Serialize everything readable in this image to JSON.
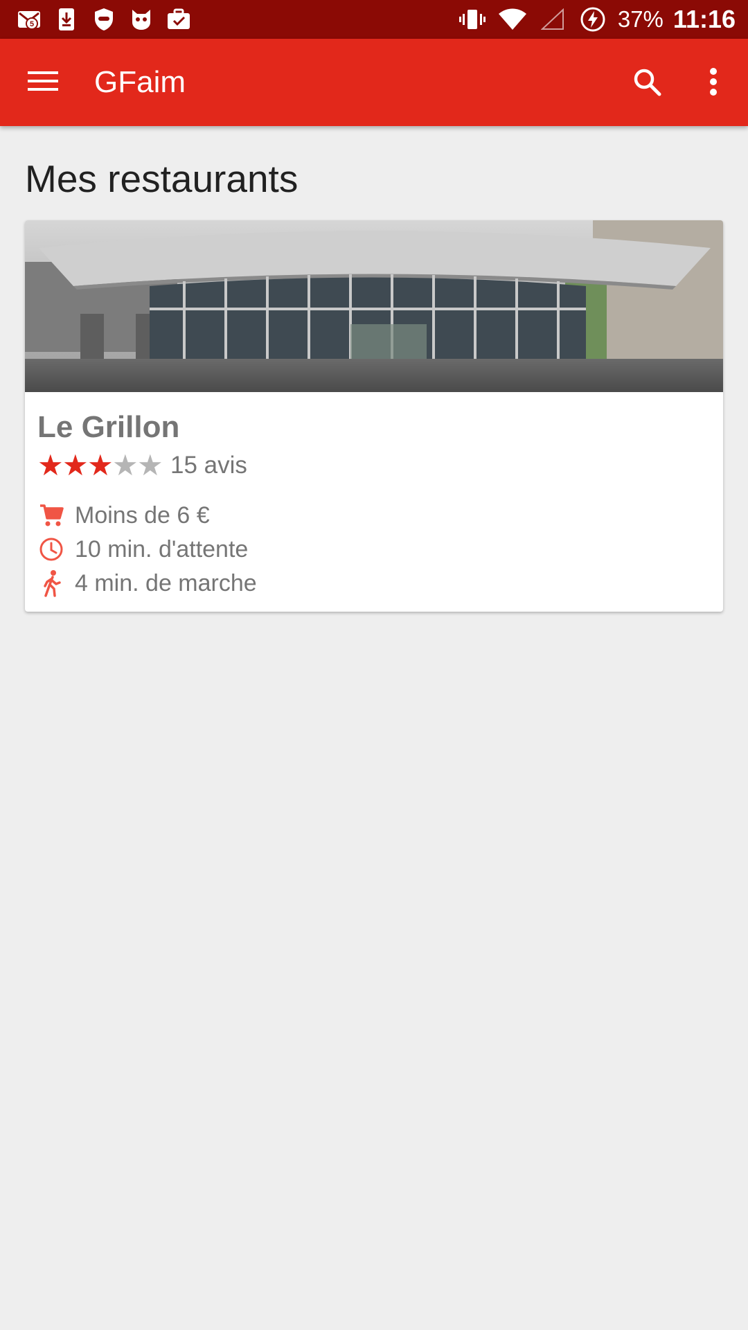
{
  "status_bar": {
    "notification_badge": "5",
    "battery_percent": "37%",
    "time": "11:16",
    "icons_left": [
      "gmail-icon",
      "download-icon",
      "shield-icon",
      "cat-mascot-icon",
      "briefcase-check-icon"
    ],
    "icons_right": [
      "vibrate-icon",
      "wifi-icon",
      "signal-icon",
      "battery-saver-icon"
    ]
  },
  "app_bar": {
    "title": "GFaim",
    "icons": [
      "menu-icon",
      "search-icon",
      "more-vert-icon"
    ],
    "color": "#e2281b"
  },
  "page": {
    "title": "Mes restaurants"
  },
  "restaurants": [
    {
      "name": "Le Grillon",
      "rating": 3,
      "rating_max": 5,
      "reviews": "15 avis",
      "price": "Moins de 6 €",
      "wait": "10 min. d'attente",
      "walk": "4 min. de marche"
    }
  ],
  "colors": {
    "status_bar": "#8b0a05",
    "accent": "#e2281b",
    "background": "#eeeeee",
    "secondary_text": "#757575"
  }
}
